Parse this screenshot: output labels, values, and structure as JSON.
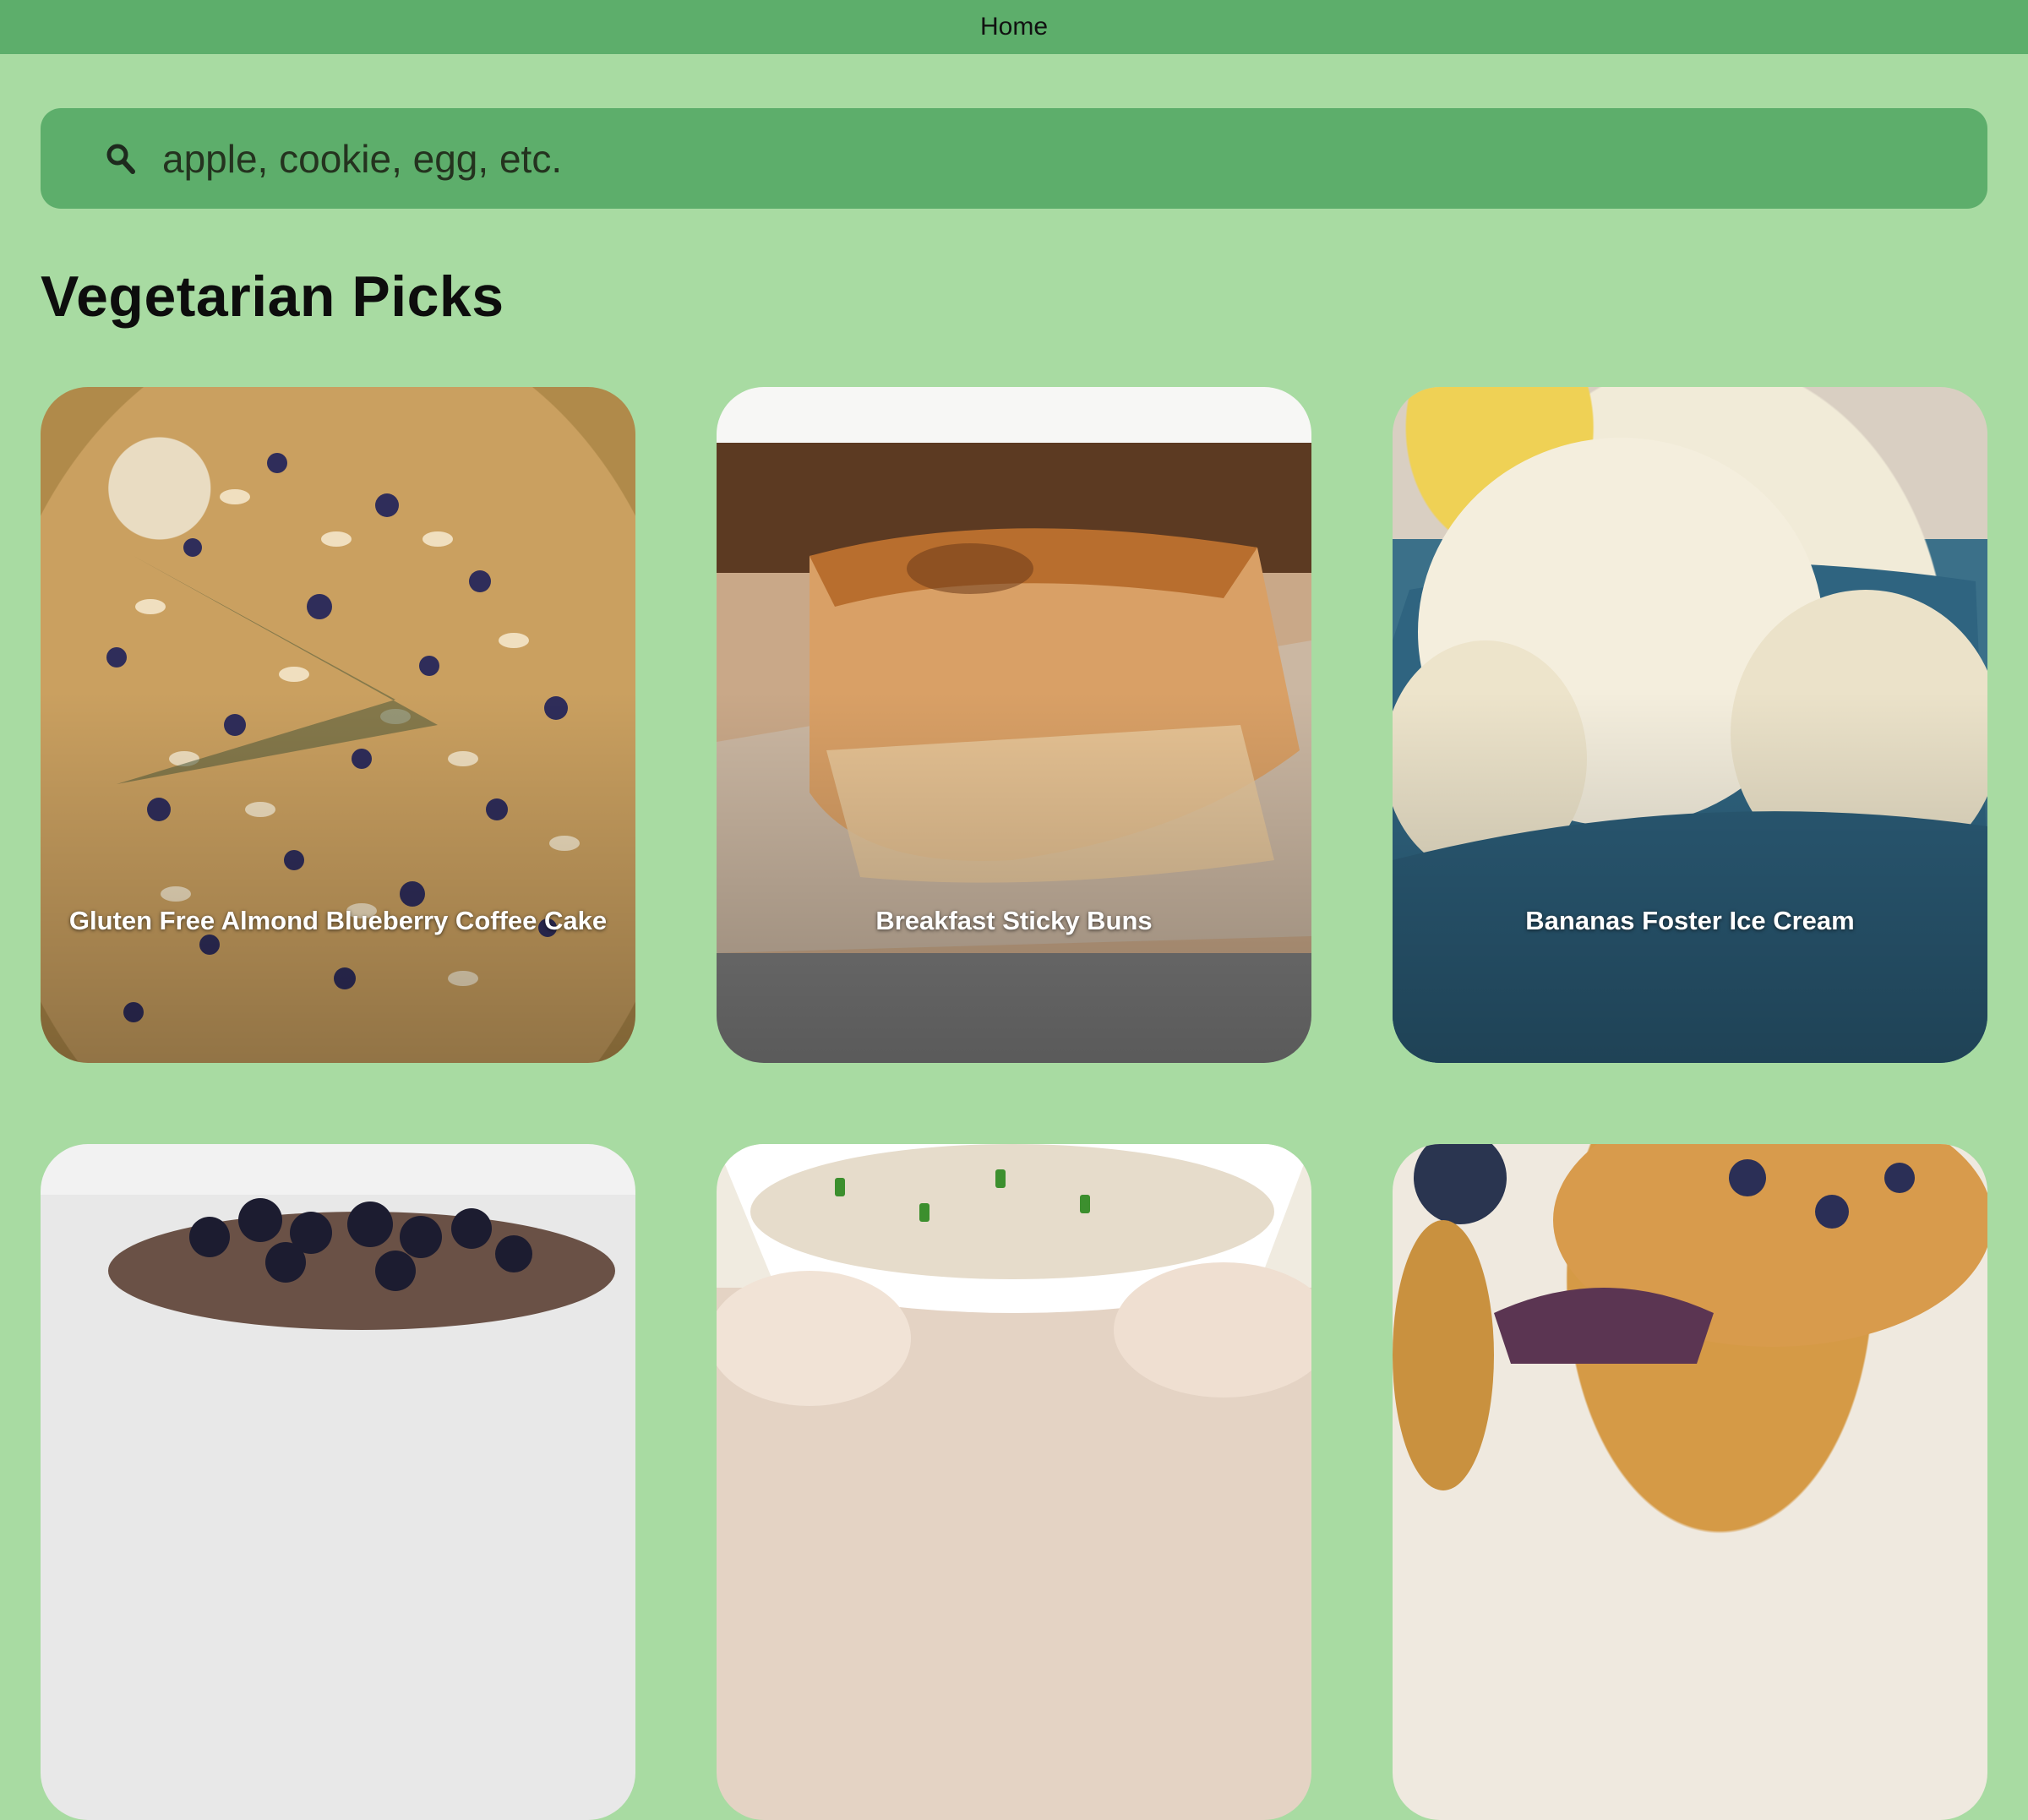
{
  "topbar": {
    "title": "Home"
  },
  "search": {
    "placeholder": "apple, cookie, egg, etc.",
    "value": ""
  },
  "section": {
    "title": "Vegetarian Picks"
  },
  "recipes": [
    {
      "title": "Gluten Free Almond Blueberry Coffee Cake"
    },
    {
      "title": "Breakfast Sticky Buns"
    },
    {
      "title": "Bananas Foster Ice Cream"
    },
    {
      "title": ""
    },
    {
      "title": ""
    },
    {
      "title": ""
    }
  ],
  "colors": {
    "background": "#a8dba2",
    "accent": "#5dae6b"
  },
  "icons": {
    "search": "search-icon"
  }
}
